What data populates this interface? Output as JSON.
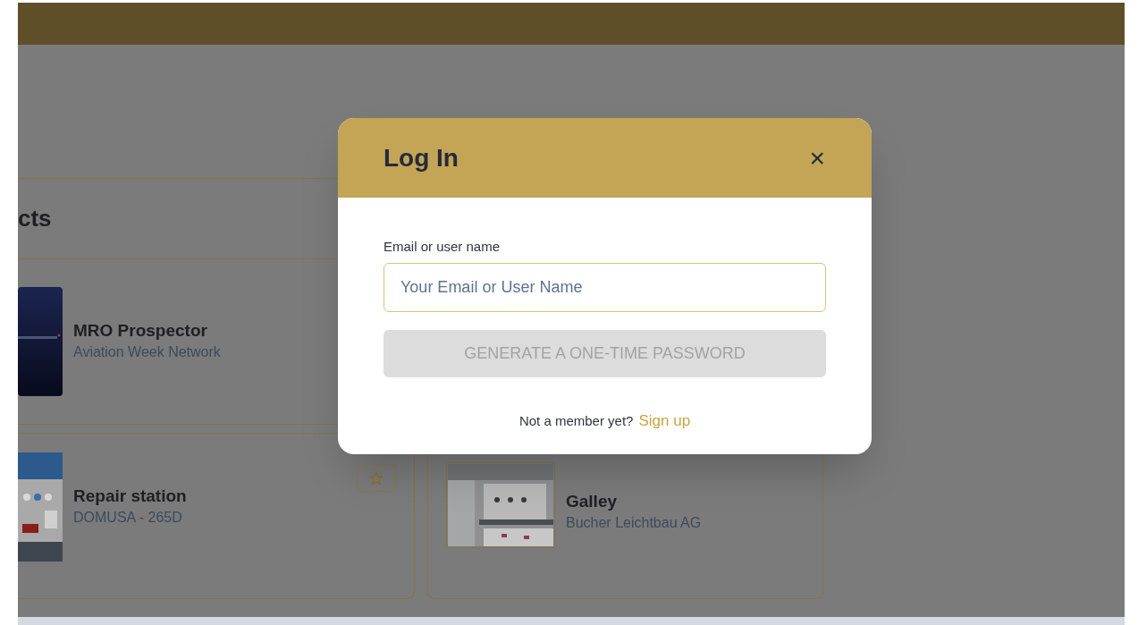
{
  "section": {
    "heading": "cts"
  },
  "products": [
    {
      "name": "MRO Prospector",
      "company": "Aviation Week Network"
    },
    {
      "name": "Repair station",
      "company": "DOMUSA - 265D",
      "favorite_button": true
    },
    {
      "name": "Galley",
      "company": "Bucher Leichtbau AG"
    }
  ],
  "modal": {
    "title": "Log In",
    "close": "×",
    "field_label": "Email or user name",
    "placeholder": "Your Email or User Name",
    "submit": {
      "label": "GENERATE A ONE-TIME PASSWORD",
      "disabled": true
    },
    "footer_text": "Not a member yet?",
    "footer_link": "Sign up"
  }
}
